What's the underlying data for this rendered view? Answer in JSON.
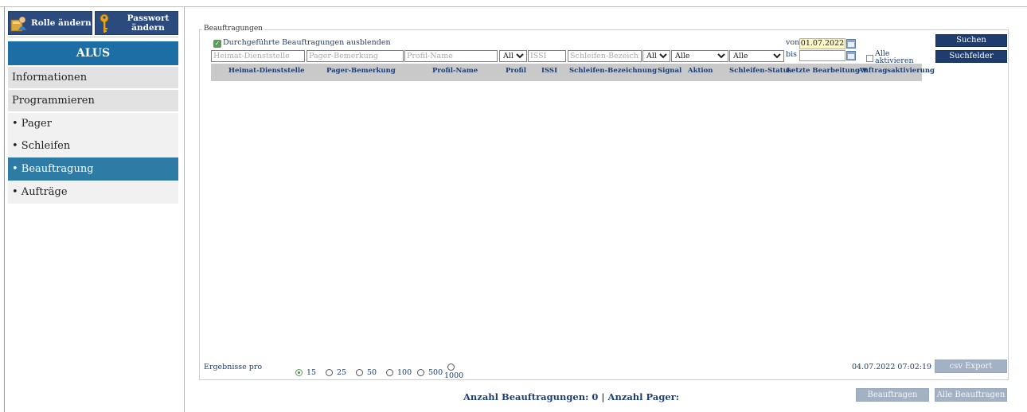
{
  "sidebar": {
    "role_button": "Rolle ändern",
    "password_button_line1": "Passwort",
    "password_button_line2": "ändern",
    "app_title": "ALUS",
    "items": [
      {
        "label": "Informationen"
      },
      {
        "label": "Programmieren"
      },
      {
        "label": "• Pager"
      },
      {
        "label": "• Schleifen"
      },
      {
        "label": "• Beauftragung"
      },
      {
        "label": "• Aufträge"
      }
    ]
  },
  "filter": {
    "legend": "Beauftragungen",
    "hide_done_label": "Durchgeführte Beauftragungen ausblenden",
    "hide_done_checked": true,
    "von_label": "von",
    "bis_label": "bis",
    "von_value": "01.07.2022",
    "bis_value": "",
    "alle_aktivieren": "Alle aktivieren",
    "placeholders": {
      "heimat": "Heimat-Dienststelle",
      "pager": "Pager-Bemerkung",
      "profil": "Profil-Name",
      "issi": "ISSI",
      "schleife": "Schleifen-Bezeichnung"
    },
    "profil_select": "Alle",
    "signal_select": "Alle",
    "aktion_select": "Alle",
    "status_select": "Alle",
    "search_button": "Suchen",
    "clear_button": "Suchfelder löschen"
  },
  "table": {
    "columns": [
      "Heimat-Dienststelle",
      "Pager-Bemerkung",
      "Profil-Name",
      "Profil",
      "ISSI",
      "Schleifen-Bezeichnung",
      "Signal",
      "Aktion",
      "Schleifen-Status",
      "Letzte Bearbeitung ▼",
      "Auftragsaktivierung"
    ],
    "rows": []
  },
  "footer": {
    "ergebnisse_label": "Ergebnisse pro Seite",
    "page_sizes": [
      "15",
      "25",
      "50",
      "100",
      "500",
      "1000"
    ],
    "selected_page_size": "15",
    "timestamp": "04.07.2022 07:02:19",
    "csv_button": "csv Export",
    "summary": "Anzahl Beauftragungen: 0 | Anzahl Pager:",
    "beauftragen_button": "Beauftragen",
    "alle_beauftragen_button": "Alle Beauftragen"
  },
  "colors": {
    "nav_header": "#1c6ea4",
    "nav_active": "#2e7ca6",
    "button_primary": "#1e3d6e",
    "button_disabled": "#a3b1c4",
    "date_highlight": "#fbf6c3"
  }
}
